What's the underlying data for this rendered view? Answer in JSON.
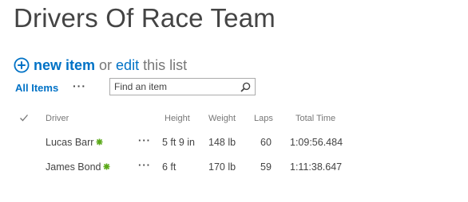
{
  "list": {
    "title": "Drivers Of Race Team",
    "new_item_label": "new item",
    "or_text": "or",
    "edit_label": "edit",
    "this_list_text": "this list"
  },
  "view": {
    "current_view": "All Items",
    "more_options": "···"
  },
  "search": {
    "placeholder": "Find an item"
  },
  "table": {
    "columns": {
      "driver": "Driver",
      "height": "Height",
      "weight": "Weight",
      "laps": "Laps",
      "total_time": "Total Time"
    },
    "row_menu": "···",
    "rows": [
      {
        "driver": "Lucas Barr",
        "height": "5 ft 9 in",
        "weight": "148 lb",
        "laps": "60",
        "total_time": "1:09:56.484"
      },
      {
        "driver": "James Bond",
        "height": "6 ft",
        "weight": "170 lb",
        "laps": "59",
        "total_time": "1:11:38.647"
      }
    ]
  },
  "colors": {
    "accent": "#0072c6",
    "text": "#444444",
    "muted": "#777777",
    "new_badge": "#5aa818"
  },
  "icons": {
    "add": "circle-plus-icon",
    "search": "magnifier-icon",
    "select_all": "checkmark-icon",
    "new": "new-badge-icon"
  }
}
